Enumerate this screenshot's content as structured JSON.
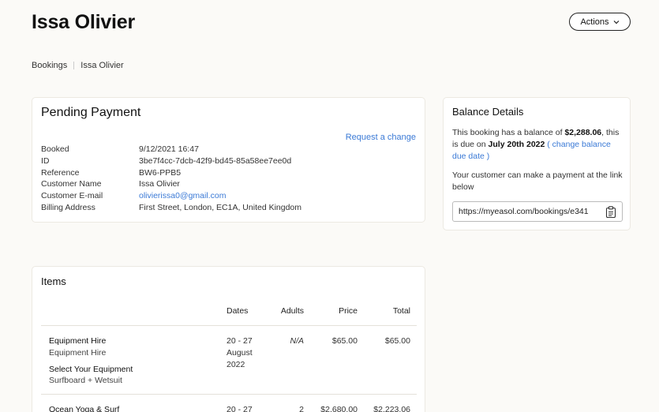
{
  "header": {
    "title": "Issa Olivier",
    "actions_label": "Actions"
  },
  "breadcrumb": [
    "Bookings",
    "Issa Olivier"
  ],
  "pending": {
    "heading": "Pending Payment",
    "request_change": "Request a change",
    "fields": [
      {
        "label": "Booked",
        "value": "9/12/2021 16:47"
      },
      {
        "label": "ID",
        "value": "3be7f4cc-7dcb-42f9-bd45-85a58ee7ee0d"
      },
      {
        "label": "Reference",
        "value": "BW6-PPB5"
      },
      {
        "label": "Customer Name",
        "value": "Issa Olivier"
      },
      {
        "label": "Customer E-mail",
        "value": "olivierissa0@gmail.com"
      },
      {
        "label": "Billing Address",
        "value": "First Street, London, EC1A, United Kingdom"
      }
    ]
  },
  "balance": {
    "heading": "Balance Details",
    "text_pre": "This booking has a balance of ",
    "amount": "$2,288.06",
    "text_mid": ", this is due on ",
    "due_date": "July 20th 2022",
    "change_link": " ( change balance due date )",
    "payment_text": "Your customer can make a payment at the link below",
    "url": "https://myeasol.com/bookings/e341"
  },
  "items": {
    "heading": "Items",
    "columns": {
      "dates": "Dates",
      "adults": "Adults",
      "price": "Price",
      "total": "Total"
    },
    "rows": [
      {
        "name": "Equipment Hire",
        "sub": "Equipment Hire",
        "section": "Select Your Equipment",
        "section_value": "Surfboard + Wetsuit",
        "dates": "20 - 27",
        "dates2": "August",
        "dates3": "2022",
        "adults": "N/A",
        "price": "$65.00",
        "total": "$65.00"
      },
      {
        "name": "Ocean Yoga & Surf",
        "dates": "20 - 27",
        "adults": "2",
        "price": "$2,680.00",
        "total": "$2,223.06"
      }
    ]
  }
}
